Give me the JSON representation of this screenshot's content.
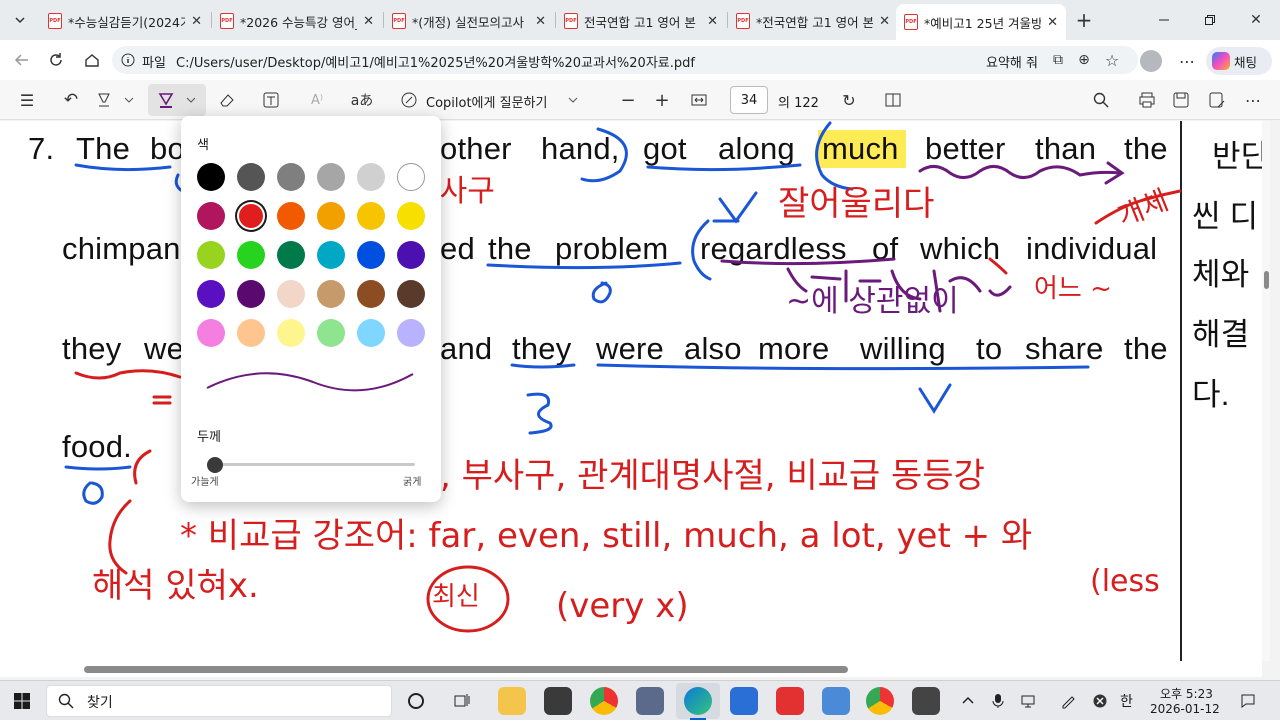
{
  "browser": {
    "tabs": [
      {
        "label": "*수능실감듣기(2024기"
      },
      {
        "label": "*2026 수능특강 영어_"
      },
      {
        "label": "*(개정) 실전모의고사"
      },
      {
        "label": "전국연합 고1 영어 본"
      },
      {
        "label": "*전국연합 고1 영어 본"
      },
      {
        "label": "*예비고1 25년 겨울방"
      }
    ],
    "address": {
      "scheme_label": "파일",
      "url": "C:/Users/user/Desktop/예비고1/예비고1%2025년%20겨울방학%20교과서%20자료.pdf",
      "summarize_label": "요약해 줘"
    },
    "copilot_chat_label": "채팅"
  },
  "pdf_toolbar": {
    "copilot_label": "Copilot에게 질문하기",
    "page_current": "34",
    "page_total": "의 122"
  },
  "document": {
    "lines": [
      {
        "parts": [
          "7.",
          "The",
          "bo",
          "other",
          "hand,",
          "got",
          "along",
          "much",
          "better",
          "than",
          "the"
        ]
      },
      {
        "parts": [
          "chimpan",
          "ed",
          "the",
          "problem",
          "regardless",
          "of",
          "which",
          "individual"
        ]
      },
      {
        "parts": [
          "they",
          "we",
          "and",
          "they",
          "were",
          "also",
          "more",
          "willing",
          "to",
          "share",
          "the"
        ]
      },
      {
        "parts": [
          "food."
        ]
      }
    ],
    "right_column": [
      "반단",
      "씬 디",
      "체와",
      "해결",
      "다."
    ]
  },
  "annotations": {
    "korean": [
      "부사구",
      "잘어울리다",
      "개체",
      "~에 상관없이",
      "어느 ~",
      ", 부사구, 관계대명사절, 비교급 동등강",
      "* 비교급 강조어: far, even, still, much, a lot, yet + 와",
      "해석 있혀x.",
      "(very x)",
      "(less",
      "최신"
    ]
  },
  "color_picker": {
    "color_title": "색",
    "thickness_title": "두께",
    "thin_label": "가늘게",
    "thick_label": "굵게",
    "selected_color": "#e01e1e",
    "preview_color": "#6a1a7a",
    "thickness_value": 0.0,
    "colors": [
      "#000000",
      "#555555",
      "#7f7f7f",
      "#a6a6a6",
      "#d0d0d0",
      "#ffffff",
      "#b0155e",
      "#e01e1e",
      "#f25a00",
      "#f29f00",
      "#f7c400",
      "#f7e000",
      "#98d31f",
      "#27d31f",
      "#00794b",
      "#00a8c6",
      "#0050e0",
      "#4c0fb0",
      "#5a0fc0",
      "#5a0a6e",
      "#f2d6c7",
      "#c79a6b",
      "#8b4d21",
      "#5a3a2a",
      "#f57fe0",
      "#ffc58f",
      "#fff58f",
      "#8fe58f",
      "#7fd6ff",
      "#b8b2ff"
    ]
  },
  "taskbar": {
    "search_label": "찾기",
    "time": "오후 5:23",
    "date": "2026-01-12",
    "ime_label": "한"
  }
}
